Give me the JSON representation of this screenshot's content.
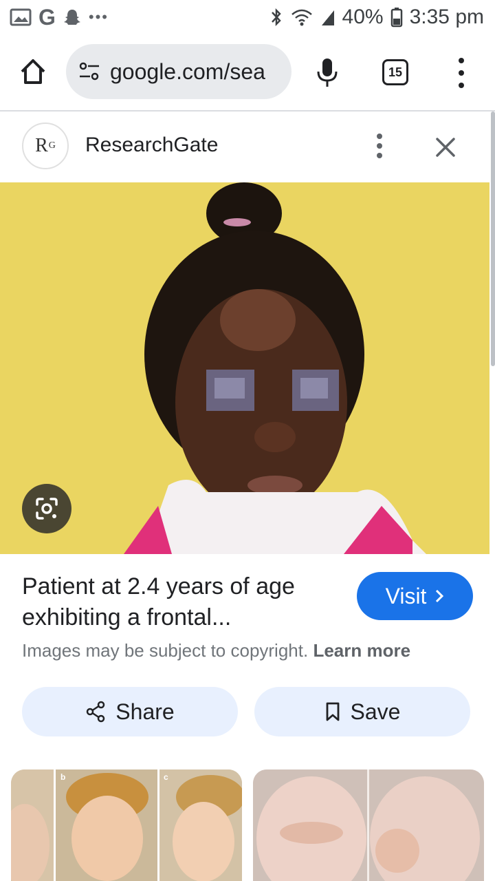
{
  "status_bar": {
    "battery": "40%",
    "time": "3:35 pm",
    "more": "•••"
  },
  "browser": {
    "url": "google.com/sea",
    "tab_count": "15"
  },
  "source": {
    "logo_text": "R",
    "logo_sup": "G",
    "name": "ResearchGate"
  },
  "result": {
    "caption": "Patient at 2.4 years of age exhibiting a frontal...",
    "visit_label": "Visit",
    "copyright_text": "Images may be subject to copyright.",
    "learn_more_label": "Learn more"
  },
  "actions": {
    "share_label": "Share",
    "save_label": "Save"
  },
  "related": {
    "thumb1_labels": [
      "b",
      "c"
    ]
  },
  "colors": {
    "accent": "#1a73e8",
    "pill_bg": "#e8f0fe",
    "image_bg": "#e6d25a",
    "lens_bg": "#4a4632"
  }
}
